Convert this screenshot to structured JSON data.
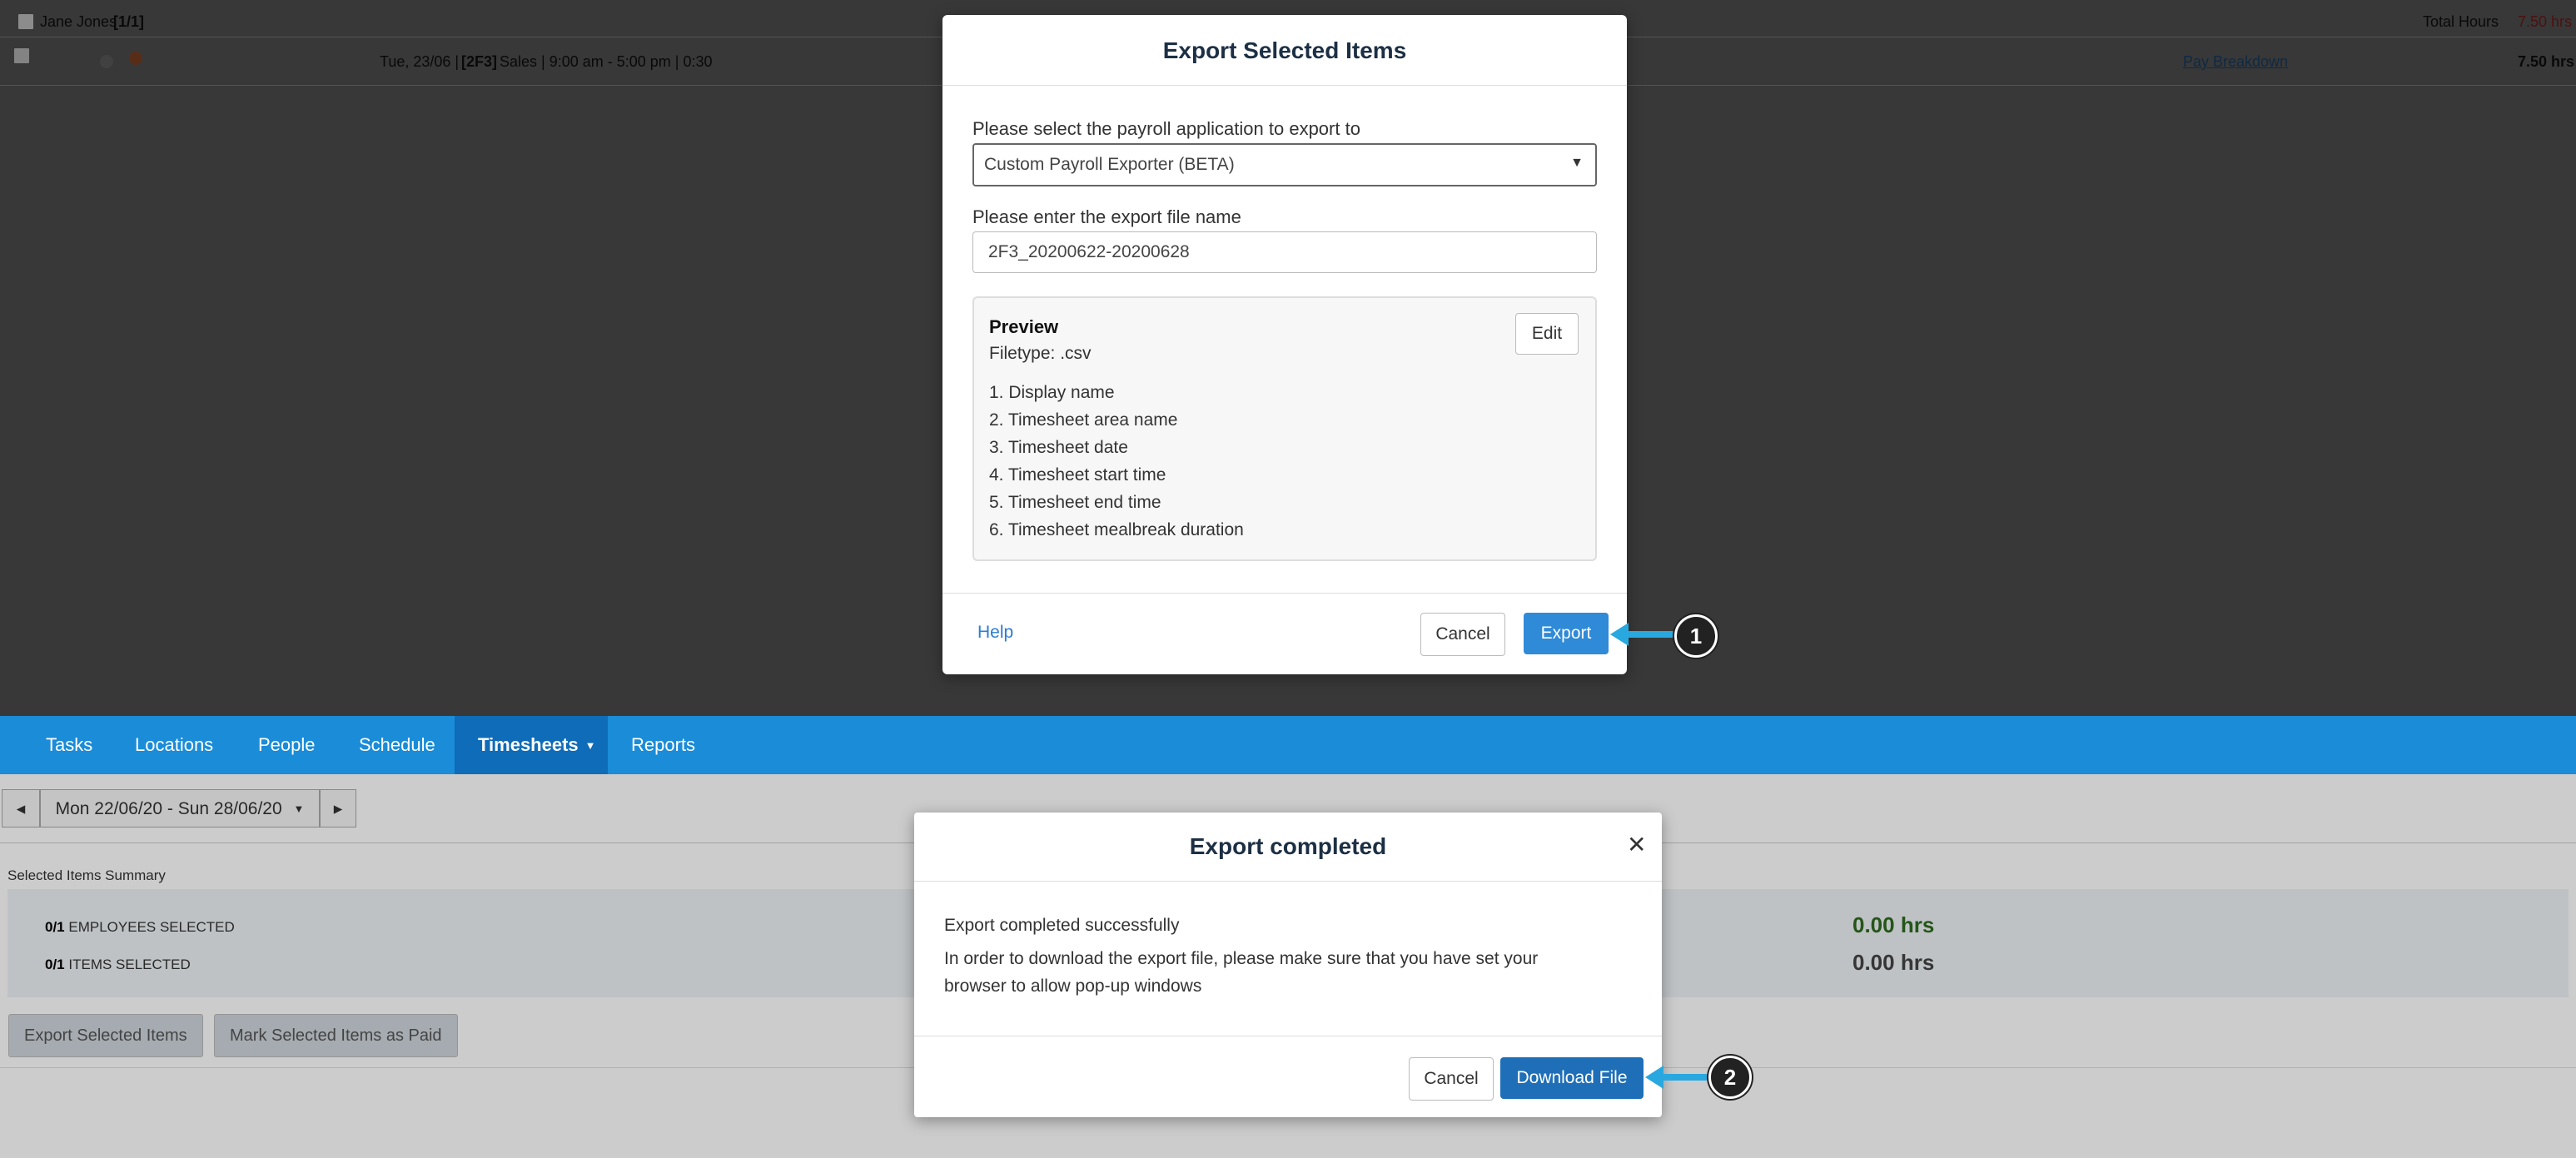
{
  "background_table": {
    "employee_name": "Jane Jones",
    "employee_count": "[1/1]",
    "total_hours_label": "Total Hours",
    "total_hours_value": "7.50 hrs",
    "shift_prefix": "Tue, 23/06 |",
    "shift_area": "[2F3]",
    "shift_suffix": "Sales | 9:00 am - 5:00 pm | 0:30",
    "pay_breakdown_link": "Pay Breakdown",
    "shift_hours": "7.50 hrs"
  },
  "export_modal": {
    "title": "Export Selected Items",
    "payroll_label": "Please select the payroll application to export to",
    "payroll_selected": "Custom Payroll Exporter (BETA)",
    "filename_label": "Please enter the export file name",
    "filename_value": "2F3_20200622-20200628",
    "preview": {
      "title": "Preview",
      "filetype": "Filetype: .csv",
      "edit_label": "Edit",
      "columns": [
        "1. Display name",
        "2. Timesheet area name",
        "3. Timesheet date",
        "4. Timesheet start time",
        "5. Timesheet end time",
        "6. Timesheet mealbreak duration"
      ]
    },
    "help_label": "Help",
    "cancel_label": "Cancel",
    "export_label": "Export"
  },
  "nav": {
    "items": [
      "Tasks",
      "Locations",
      "People",
      "Schedule",
      "Timesheets",
      "Reports"
    ],
    "active": "Timesheets"
  },
  "date_range": {
    "prev_icon": "caret-left-icon",
    "label": "Mon 22/06/20 - Sun 28/06/20",
    "next_icon": "caret-right-icon"
  },
  "summary": {
    "label": "Selected Items Summary",
    "employees_count": "0/1",
    "employees_text": "EMPLOYEES SELECTED",
    "items_count": "0/1",
    "items_text": "ITEMS SELECTED",
    "employees_hours": "0.00 hrs",
    "items_hours": "0.00 hrs"
  },
  "actions": {
    "export_selected": "Export Selected Items",
    "mark_paid": "Mark Selected Items as Paid"
  },
  "done_modal": {
    "title": "Export completed",
    "close_icon": "close-icon",
    "message_1": "Export completed successfully",
    "message_2": "In order to download the export file, please make sure that you have set your",
    "message_3": "browser to allow pop-up windows",
    "cancel_label": "Cancel",
    "download_label": "Download File"
  },
  "callouts": [
    "1",
    "2"
  ],
  "colors": {
    "nav_bar": "#1a8cd8",
    "nav_active": "#0f6cb8",
    "primary_button": "#2f8ad8",
    "download_button": "#1f6fb8",
    "callout_arrow": "#29a8e0",
    "hours_green": "#2f6b1e"
  }
}
